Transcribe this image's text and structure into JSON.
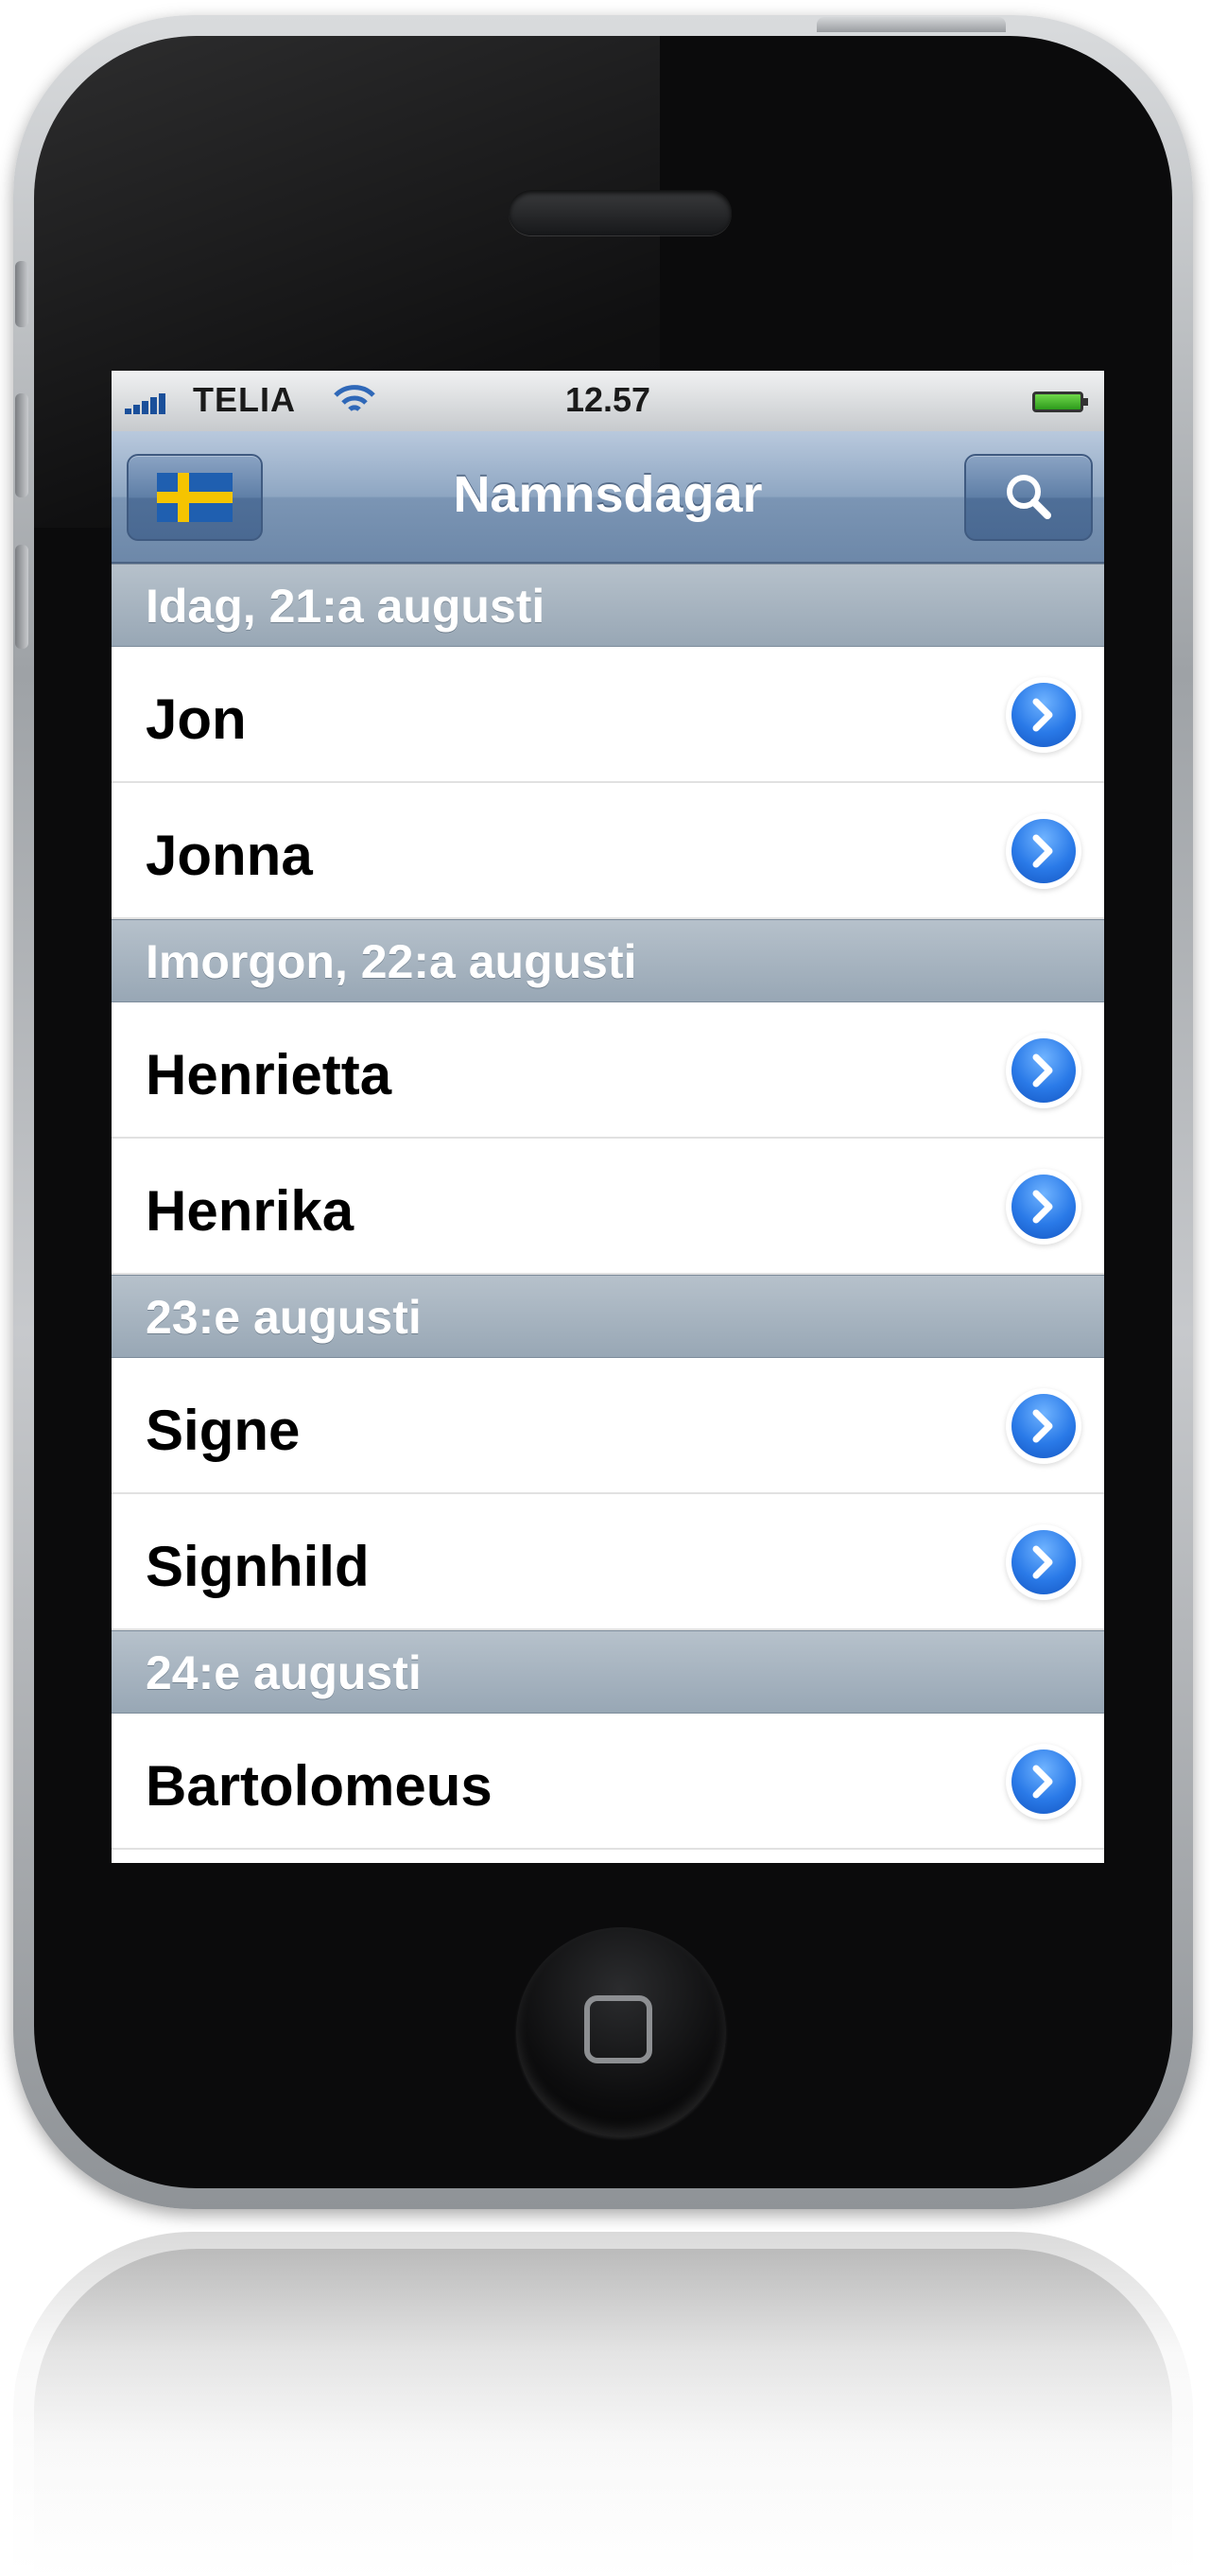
{
  "status_bar": {
    "carrier": "TELIA",
    "time": "12.57"
  },
  "nav": {
    "title": "Namnsdagar",
    "left_button_icon": "swedish-flag-icon",
    "right_button_icon": "search-icon"
  },
  "sections": [
    {
      "header": "Idag, 21:a augusti",
      "names": [
        "Jon",
        "Jonna"
      ]
    },
    {
      "header": "Imorgon, 22:a augusti",
      "names": [
        "Henrietta",
        "Henrika"
      ]
    },
    {
      "header": "23:e augusti",
      "names": [
        "Signe",
        "Signhild"
      ]
    },
    {
      "header": "24:e augusti",
      "names": [
        "Bartolomeus"
      ]
    }
  ],
  "colors": {
    "nav_bar": "#7b95b4",
    "section_header": "#98a7b5",
    "disclosure": "#2a7ae8",
    "flag_blue": "#1f5fb0",
    "flag_yellow": "#f5c400"
  }
}
